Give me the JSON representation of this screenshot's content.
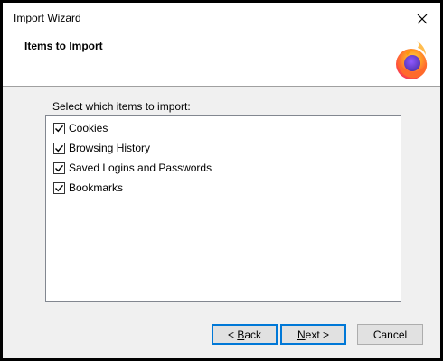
{
  "window": {
    "title": "Import Wizard",
    "close_label": "Close"
  },
  "header": {
    "heading": "Items to Import",
    "logo_icon": "firefox-logo"
  },
  "content": {
    "prompt": "Select which items to import:",
    "items": [
      {
        "label": "Cookies",
        "checked": true
      },
      {
        "label": "Browsing History",
        "checked": true
      },
      {
        "label": "Saved Logins and Passwords",
        "checked": true
      },
      {
        "label": "Bookmarks",
        "checked": true
      }
    ]
  },
  "buttons": {
    "back": {
      "prefix": "< ",
      "mnemonic": "B",
      "rest": "ack"
    },
    "next": {
      "mnemonic": "N",
      "rest": "ext >"
    },
    "cancel": {
      "label": "Cancel"
    }
  },
  "colors": {
    "accent_border": "#0078d7",
    "dialog_bg": "#f0f0f0",
    "header_bg": "#ffffff"
  }
}
